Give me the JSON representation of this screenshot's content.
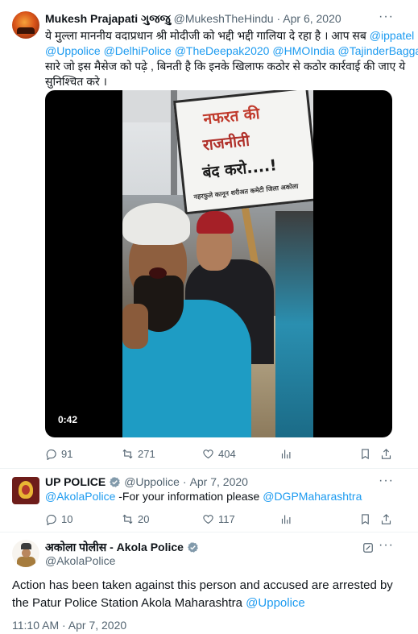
{
  "tweet1": {
    "author_name": "Mukesh Prajapati ગુજજુ",
    "handle": "@MukeshTheHindu",
    "separator": "·",
    "date": "Apr 6, 2020",
    "more_label": "···",
    "text_line1": "ये मुल्ला माननीय वदाप्रधान श्री मोदीजी को भद्दी भद्दी गालिया दे रहा है । आप सब",
    "mention_ippatel": "@ippatel",
    "mention_uppolice": "@Uppolice",
    "mention_delhipolice": "@DelhiPolice",
    "mention_thedeepak": "@TheDeepak2020",
    "mention_hmoindia": "@HMOIndia",
    "mention_tajinder": "@TajinderBagga",
    "text_line3": "सारे जो इस मैसेज को पढ़े , बिनती है कि इनके खिलाफ कठोर से कठोर कार्रवाई की जाए ये",
    "text_line4": "सुनिश्चित करे ।",
    "video": {
      "duration": "0:42",
      "sign_line1": "नफरत की",
      "sign_line2": "राजनीती",
      "sign_line3": "बंद करो....!",
      "sign_line4": "नहरफुले कानून शरीअत कमेटी जिला अकोला"
    },
    "stats": {
      "replies": "91",
      "retweets": "271",
      "likes": "404"
    }
  },
  "tweet2": {
    "author_name": "UP POLICE",
    "handle": "@Uppolice",
    "separator": "·",
    "date": "Apr 7, 2020",
    "more_label": "···",
    "mention_akola": "@AkolaPolice",
    "text_middle": " -For your information please ",
    "mention_dgp": "@DGPMaharashtra",
    "stats": {
      "replies": "10",
      "retweets": "20",
      "likes": "117"
    }
  },
  "tweet3": {
    "author_name": "अकोला पोलीस - Akola Police",
    "handle": "@AkolaPolice",
    "more_label": "···",
    "body_line1": "Action has been taken against this person and accused are arrested by",
    "body_line2": "the Patur Police Station Akola Maharashtra ",
    "mention_uppolice": "@Uppolice",
    "timestamp": "11:10 AM · Apr 7, 2020"
  },
  "colors": {
    "link": "#1d9bf0",
    "muted": "#536471",
    "text": "#0f1419",
    "verified": "#829aab",
    "divider": "#eff3f4"
  },
  "icons": [
    "reply-icon",
    "retweet-icon",
    "like-icon",
    "views-icon",
    "bookmark-icon",
    "share-icon",
    "verified-badge-icon",
    "grok-icon"
  ]
}
